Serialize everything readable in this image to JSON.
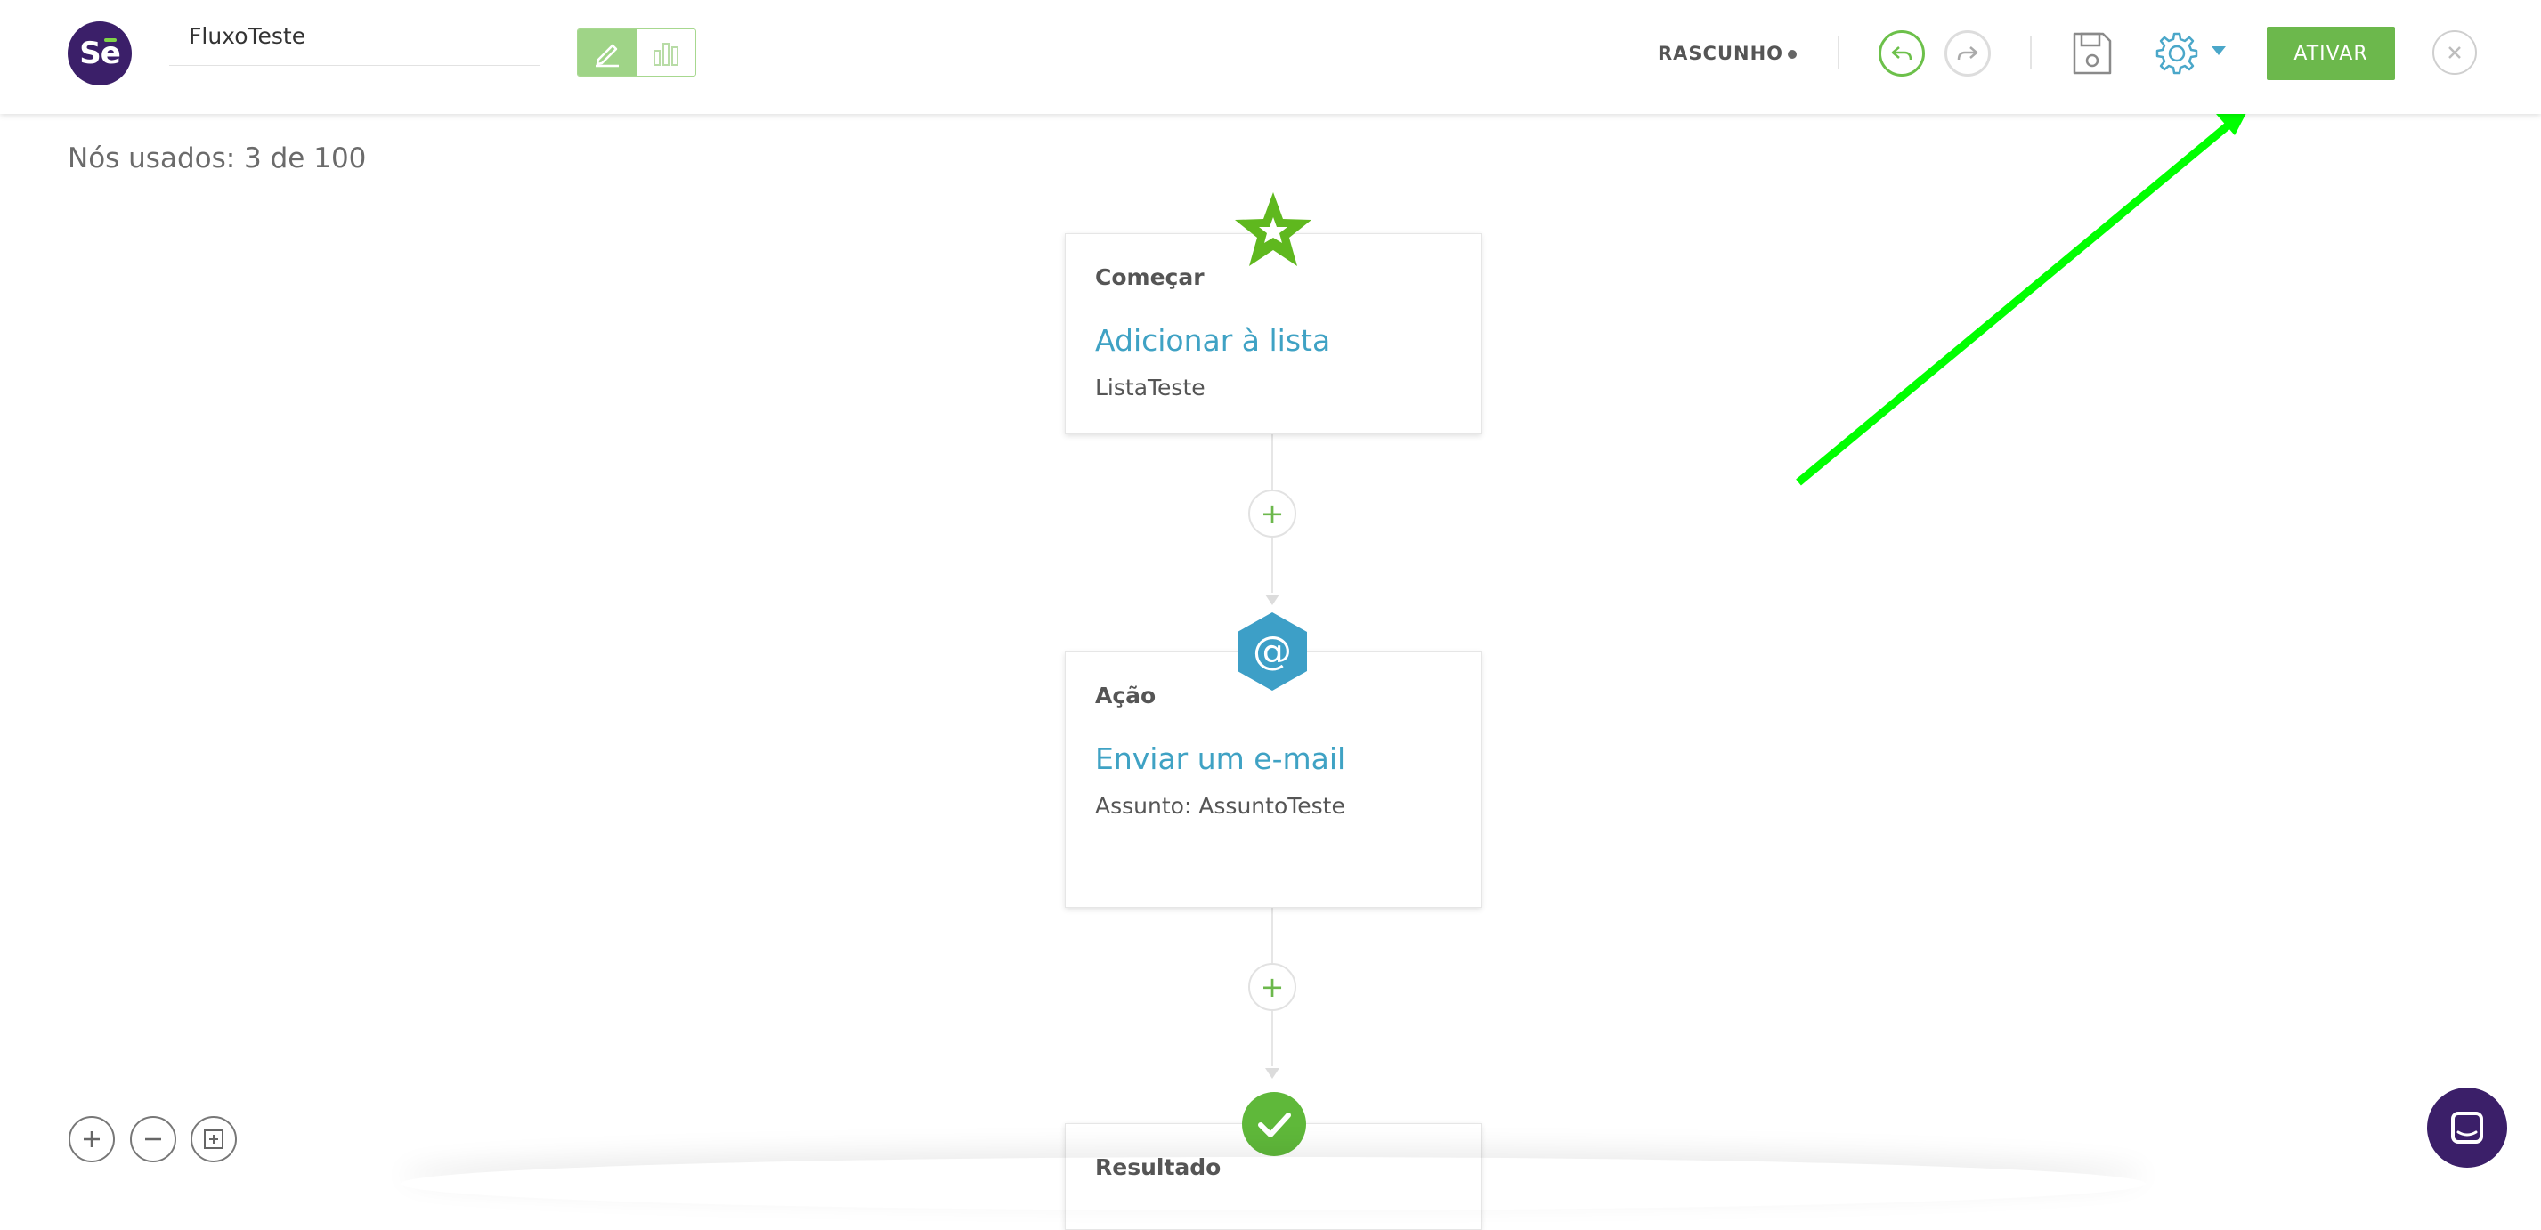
{
  "header": {
    "logo_text": "Se",
    "flow_name": "FluxoTeste",
    "status": "RASCUNHO",
    "activate_label": "ATIVAR",
    "brand_color": "#3b1f69",
    "accent_green": "#6cb84c",
    "accent_blue": "#4aa7c9"
  },
  "canvas": {
    "nodes_used": "Nós usados: 3 de 100",
    "nodes": [
      {
        "type": "Começar",
        "title": "Adicionar à lista",
        "detail": "ListaTeste",
        "icon": "star-icon"
      },
      {
        "type": "Ação",
        "title": "Enviar um e-mail",
        "detail": "Assunto: AssuntoTeste",
        "icon": "at-sign-icon"
      },
      {
        "type": "Resultado",
        "icon": "checkmark-icon"
      }
    ],
    "add_symbol": "+"
  },
  "annotation": {
    "arrow_color": "#00ff00",
    "points_to": "activate-button"
  }
}
